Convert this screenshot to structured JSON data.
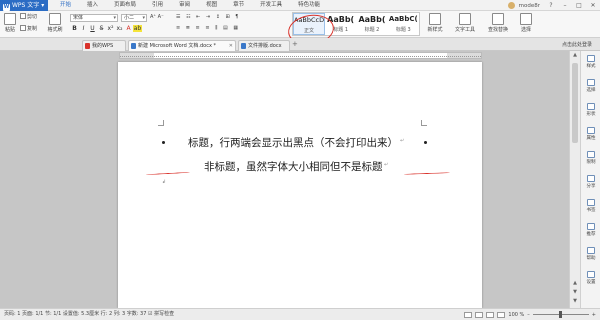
{
  "app": {
    "name": "WPS 文字",
    "user": "mode8r"
  },
  "menu": [
    "开始",
    "插入",
    "页面布局",
    "引用",
    "审阅",
    "视图",
    "章节",
    "开发工具",
    "特色功能"
  ],
  "ribbon": {
    "paste": "粘贴",
    "cut": "剪切",
    "copy": "复制",
    "format_painter": "格式刷",
    "font_name": "宋体",
    "font_size": "小二",
    "bold": "B",
    "italic": "I",
    "underline": "U",
    "styles": [
      {
        "preview": "AaBbCcDd",
        "label": "正文"
      },
      {
        "preview": "AaBb(",
        "label": "标题 1"
      },
      {
        "preview": "AaBb(",
        "label": "标题 2"
      },
      {
        "preview": "AaBbC(",
        "label": "标题 3"
      }
    ],
    "new_style": "新样式",
    "text_tools": "文字工具",
    "find_replace": "查找替换",
    "select": "选择"
  },
  "tabs": [
    {
      "label": "我的WPS"
    },
    {
      "label": "新建 Microsoft Word 文档.docx *"
    },
    {
      "label": "文件排版.docx"
    }
  ],
  "tab_right": "点击此处登录",
  "document": {
    "line1": "标题，行两端会显示出黑点（不会打印出来）",
    "line2": "非标题，虽然字体大小相同但不是标题",
    "para_mark": "↵"
  },
  "right_panel": [
    "样式",
    "选择",
    "形状",
    "属性",
    "限制",
    "分享",
    "书签",
    "推荐",
    "帮助",
    "设置"
  ],
  "status": {
    "text": "页码: 1  页面: 1/1  节: 1/1  设置值: 5.3厘米  行: 2  列: 3  字数: 37  ☑ 拼写检查",
    "zoom": "100 %"
  },
  "colors": {
    "accent": "#2b6cc4",
    "annotation_red": "#d9322b"
  }
}
